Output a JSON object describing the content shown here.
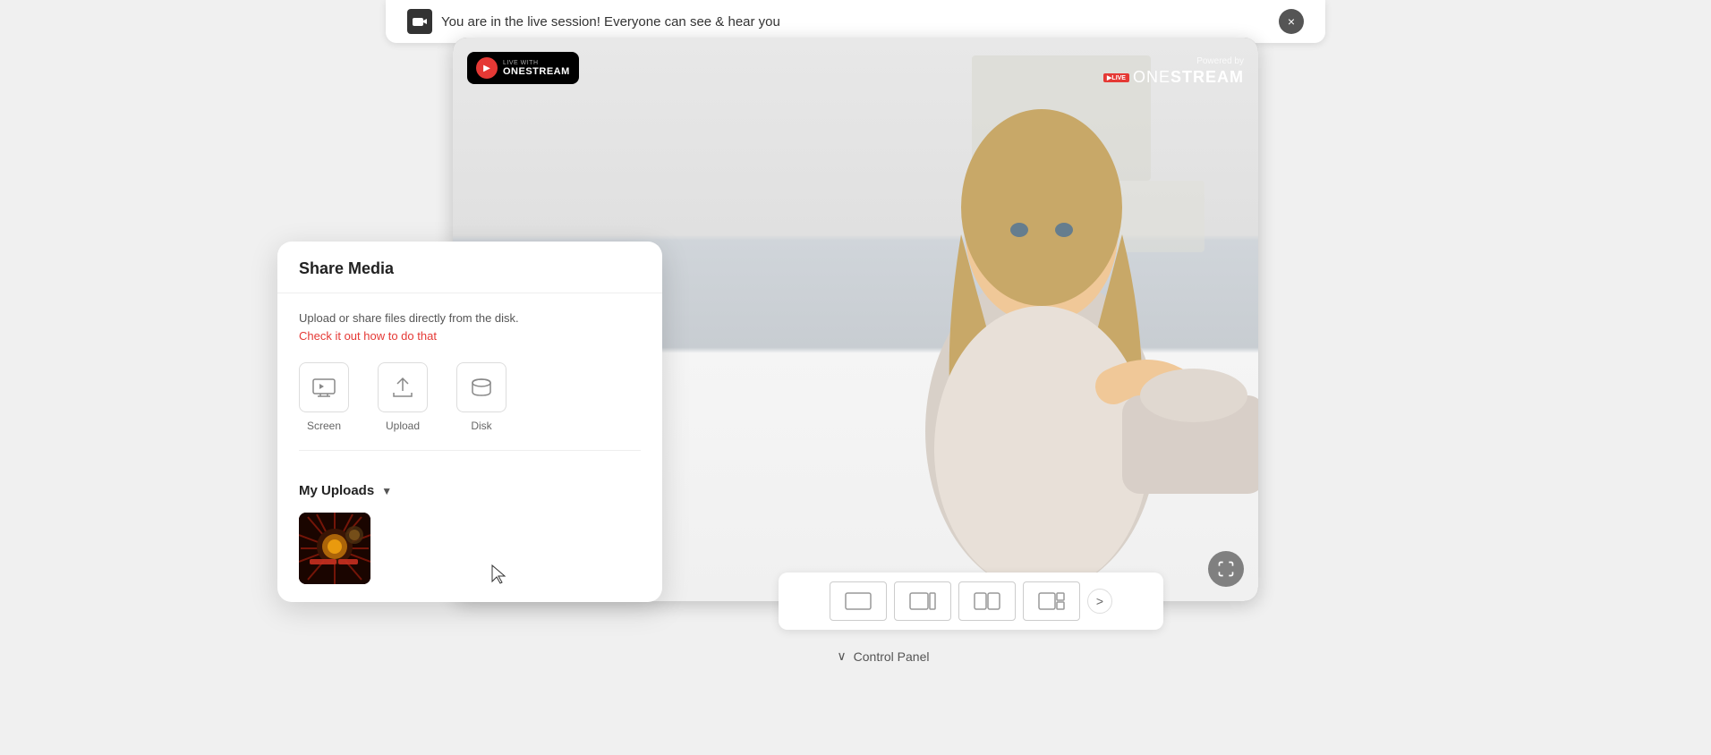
{
  "notification": {
    "text": "You are in the live session! Everyone can see & hear you",
    "close_label": "×"
  },
  "video": {
    "onestream_logo": {
      "live_with": "LIVE WITH",
      "name": "ONESTREAM"
    },
    "powered_by": {
      "label": "Powered by",
      "live_badge": "▶LIVE",
      "name": "ONESTREAM"
    }
  },
  "share_media": {
    "title": "Share Media",
    "description": "Upload or share files directly from the disk.",
    "link_text": "Check it out how to do that",
    "options": [
      {
        "label": "Screen",
        "icon": "screen-icon"
      },
      {
        "label": "Upload",
        "icon": "upload-icon"
      },
      {
        "label": "Disk",
        "icon": "disk-icon"
      }
    ],
    "my_uploads": {
      "title": "My Uploads",
      "chevron": "▼"
    }
  },
  "layouts_bar": {
    "next_label": ">"
  },
  "control_panel": {
    "label": "Control Panel",
    "chevron": "∨"
  },
  "colors": {
    "accent": "#e53935",
    "text_primary": "#222",
    "text_secondary": "#555",
    "border": "#eee"
  }
}
